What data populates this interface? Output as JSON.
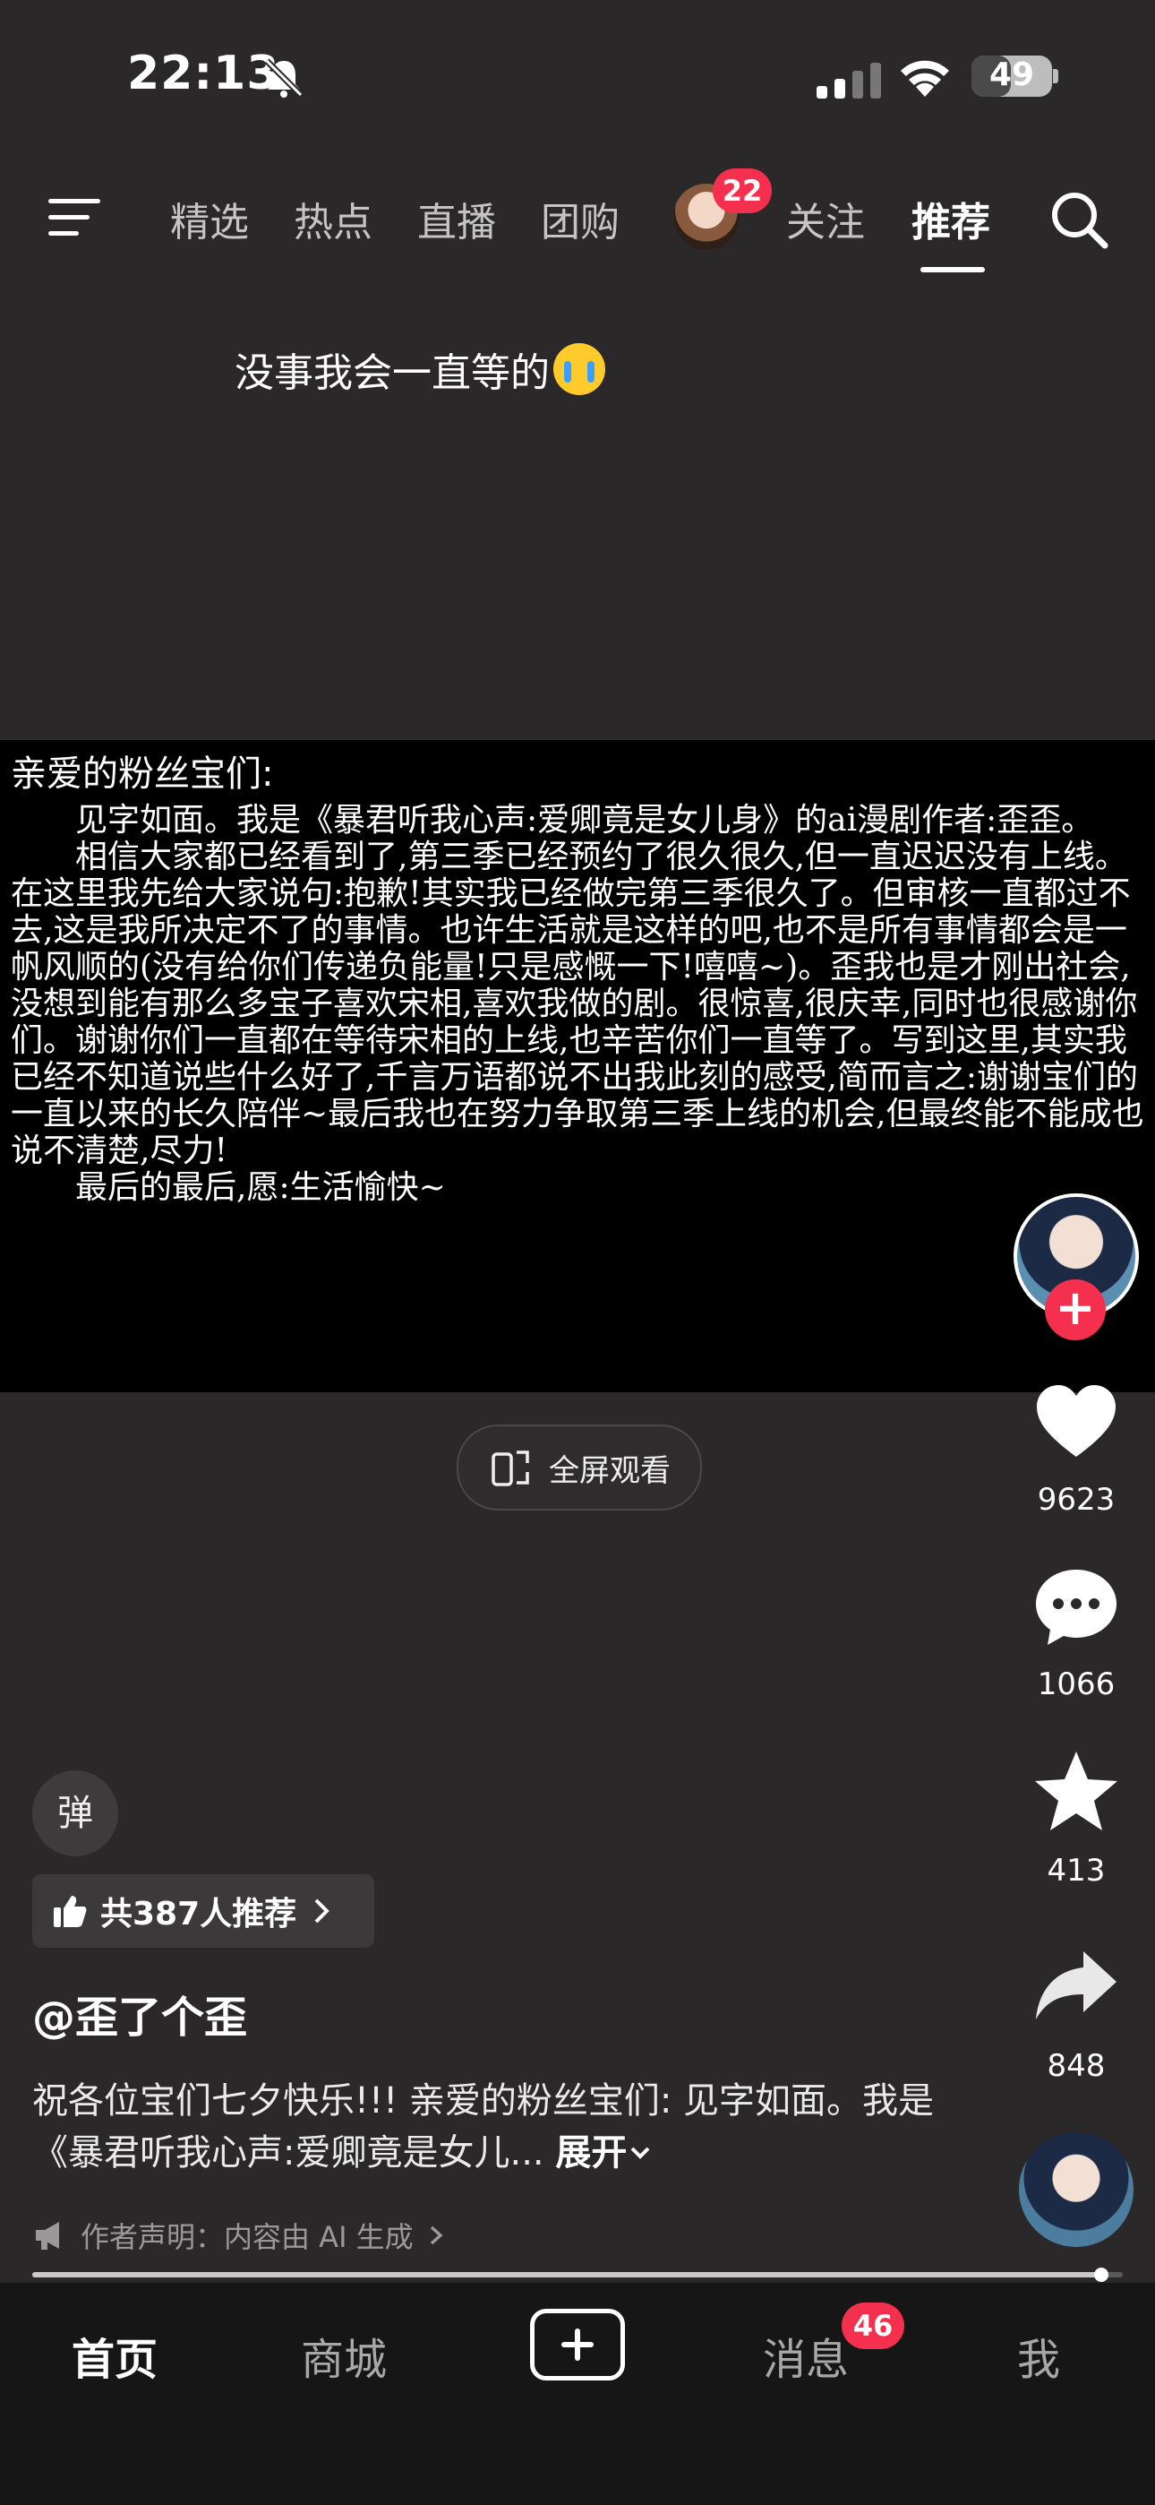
{
  "status_bar": {
    "time": "22:13",
    "battery": "49",
    "battery_percent": 49
  },
  "top_nav": {
    "tabs": [
      {
        "label": "精选"
      },
      {
        "label": "热点"
      },
      {
        "label": "直播"
      },
      {
        "label": "团购"
      },
      {
        "label": "关注"
      },
      {
        "label": "推荐"
      }
    ],
    "active_tab": "推荐",
    "follow_badge": "22"
  },
  "video": {
    "caption_top": "没事我会一直等的",
    "letter": {
      "greeting": "亲爱的粉丝宝们:",
      "para1": "　　见字如面。我是《暴君听我心声:爱卿竟是女儿身》的ai漫剧作者:歪歪。",
      "para2": "　　相信大家都已经看到了,第三季已经预约了很久很久,但一直迟迟没有上线。在这里我先给大家说句:抱歉!其实我已经做完第三季很久了。但审核一直都过不去,这是我所决定不了的事情。也许生活就是这样的吧,也不是所有事情都会是一帆风顺的(没有给你们传递负能量!只是感慨一下!嘻嘻~)。歪我也是才刚出社会,没想到能有那么多宝子喜欢宋相,喜欢我做的剧。很惊喜,很庆幸,同时也很感谢你们。谢谢你们一直都在等待宋相的上线,也辛苦你们一直等了。写到这里,其实我已经不知道说些什么好了,千言万语都说不出我此刻的感受,简而言之:谢谢宝们的一直以来的长久陪伴~最后我也在努力争取第三季上线的机会,但最终能不能成也说不清楚,尽力!",
      "para3": "　　最后的最后,愿:生活愉快~"
    },
    "fullscreen_label": "全屏观看"
  },
  "actions": {
    "likes": "9623",
    "comments": "1066",
    "favorites": "413",
    "shares": "848"
  },
  "info": {
    "danmu_label": "弹",
    "recommend_label": "共387人推荐",
    "author": "@歪了个歪",
    "description": "祝各位宝们七夕快乐!!! 亲爱的粉丝宝们: 见字如面。我是《暴君听我心声:爱卿竟是女儿...",
    "expand_label": "展开",
    "declaration": "作者声明：内容由 AI 生成",
    "progress": 0.98
  },
  "bottom_nav": {
    "home": "首页",
    "mall": "商城",
    "messages": "消息",
    "messages_badge": "46",
    "me": "我"
  },
  "colors": {
    "accent": "#f5304f",
    "background": "#2a2828",
    "letter_bg": "#000000"
  },
  "icons": [
    "bell-off-icon",
    "signal-icon",
    "wifi-icon",
    "battery-icon",
    "menu-icon",
    "search-icon",
    "fullscreen-rotate-icon",
    "plus-icon",
    "heart-icon",
    "comment-icon",
    "star-icon",
    "share-icon",
    "thumbs-up-icon",
    "chevron-right-icon",
    "megaphone-icon",
    "chevron-down-icon",
    "create-plus-icon"
  ]
}
